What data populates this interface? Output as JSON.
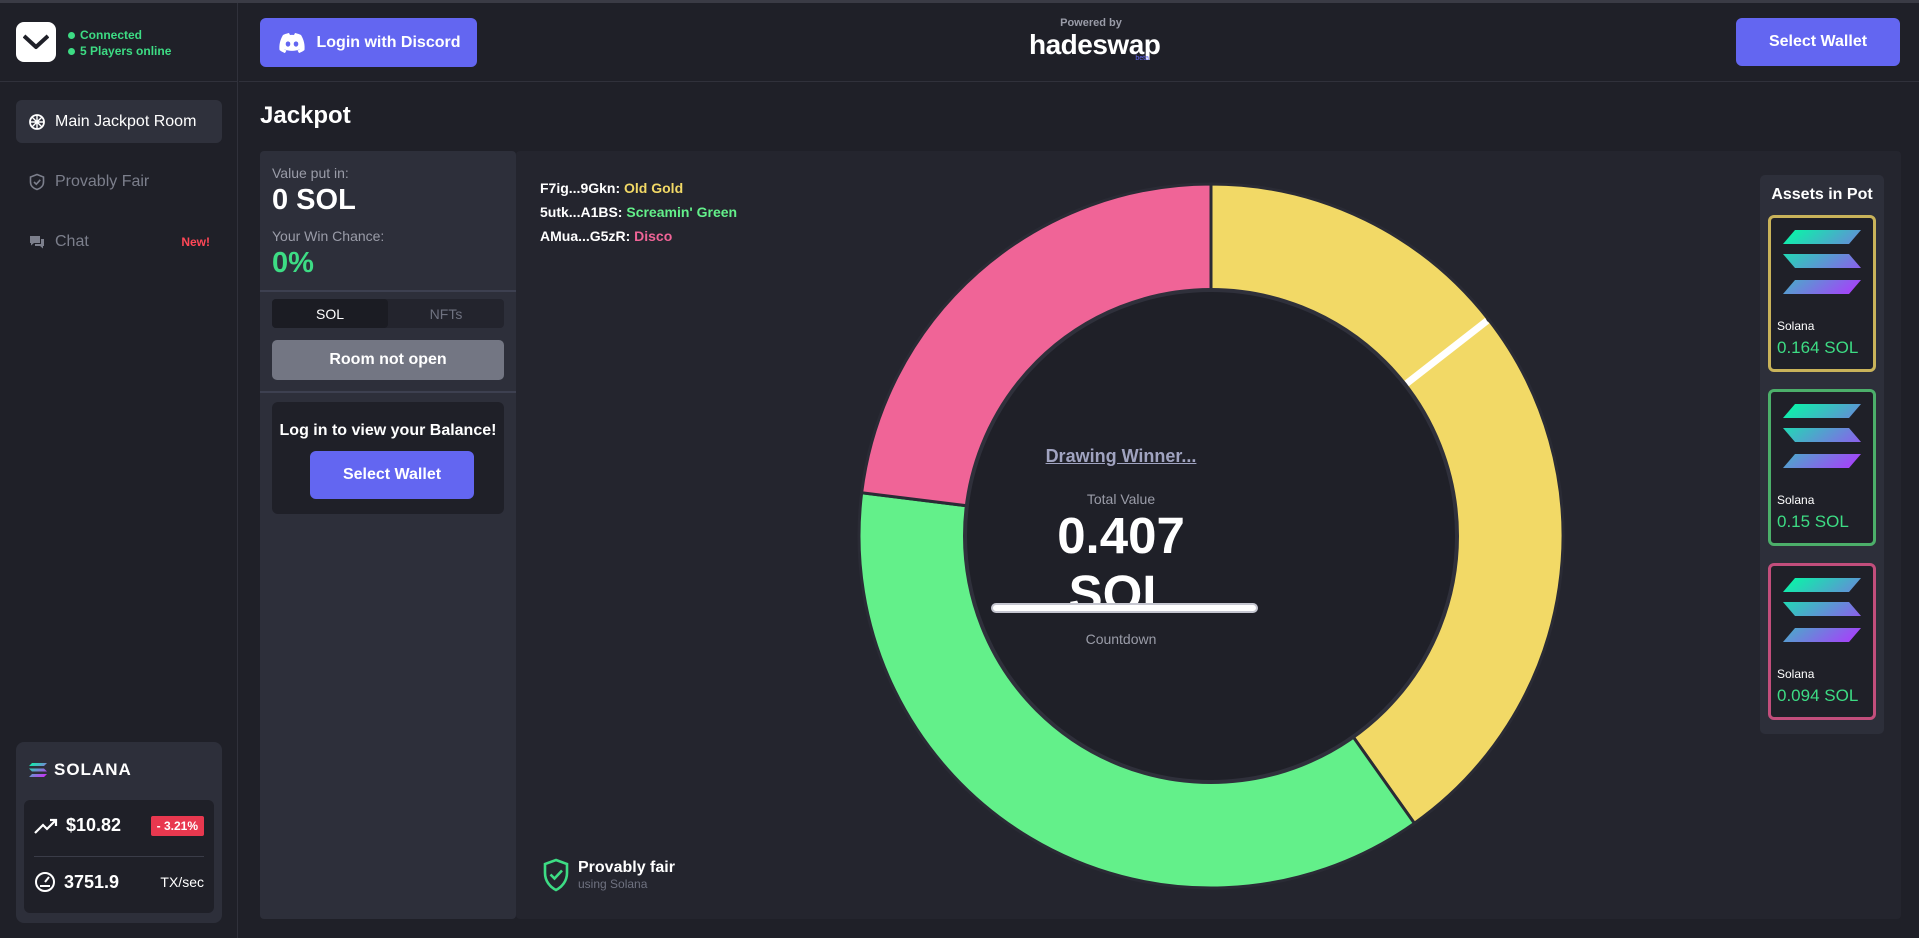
{
  "sidebar": {
    "status": {
      "connected": "Connected",
      "players_online": "5 Players online"
    },
    "nav": [
      {
        "label": "Main Jackpot Room",
        "icon": "wheel-icon",
        "active": true
      },
      {
        "label": "Provably Fair",
        "icon": "shield-check-icon"
      },
      {
        "label": "Chat",
        "icon": "chat-icon",
        "badge": "New!"
      }
    ],
    "solana_card": {
      "brand": "SOLANA",
      "price": "$10.82",
      "change": "- 3.21%",
      "tps": "3751.9",
      "tps_unit": "TX/sec"
    }
  },
  "header": {
    "discord_button": "Login with Discord",
    "powered_by": "Powered by",
    "brand": "hadeswap",
    "brand_tag": "beta",
    "select_wallet": "Select Wallet"
  },
  "page": {
    "title": "Jackpot"
  },
  "left_panel": {
    "value_label": "Value put in:",
    "value": "0 SOL",
    "win_chance_label": "Your Win Chance:",
    "win_chance": "0%",
    "tabs": [
      "SOL",
      "NFTs"
    ],
    "room_button": "Room not open",
    "balance_text": "Log in to view your Balance!",
    "select_wallet": "Select Wallet"
  },
  "main": {
    "players": [
      {
        "addr": "F7ig...9Gkn:",
        "name": "Old Gold",
        "color": "#f2d966"
      },
      {
        "addr": "5utk...A1BS:",
        "name": "Screamin' Green",
        "color": "#63f08a"
      },
      {
        "addr": "AMua...G5zR:",
        "name": "Disco",
        "color": "#f06497"
      }
    ],
    "center": {
      "drawing": "Drawing Winner...",
      "total_label": "Total Value",
      "total_value": "0.407 SOL",
      "countdown_label": "Countdown"
    },
    "provably_fair": {
      "title": "Provably fair",
      "subtitle": "using Solana"
    },
    "assets_title": "Assets in Pot",
    "assets": [
      {
        "name": "Solana",
        "amount": "0.164 SOL",
        "border": "#c9b35a"
      },
      {
        "name": "Solana",
        "amount": "0.15 SOL",
        "border": "#4caf6a"
      },
      {
        "name": "Solana",
        "amount": "0.094 SOL",
        "border": "#c24e7c"
      }
    ]
  },
  "chart_data": {
    "type": "pie",
    "slices": [
      {
        "label": "Old Gold",
        "value": 0.059,
        "color": "#f2d966"
      },
      {
        "label": "Old Gold",
        "value": 0.105,
        "color": "#f2d966"
      },
      {
        "label": "Screamin' Green",
        "value": 0.15,
        "color": "#63f08a"
      },
      {
        "label": "Disco",
        "value": 0.094,
        "color": "#f06497"
      }
    ],
    "total": 0.407
  }
}
